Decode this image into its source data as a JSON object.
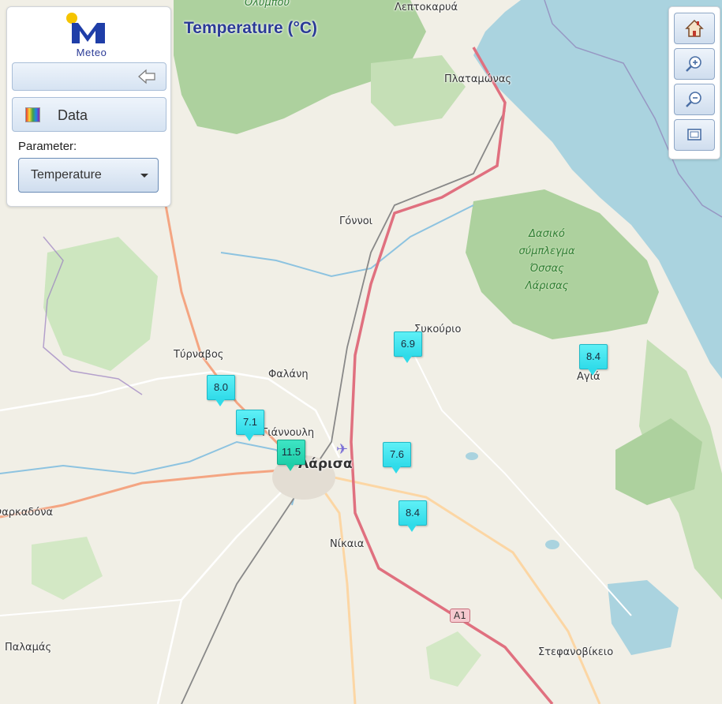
{
  "app": {
    "logo_text": "Meteo",
    "map_title": "Temperature (°C)"
  },
  "panel": {
    "data_button_label": "Data",
    "parameter_label": "Parameter:",
    "parameter_selected": "Temperature"
  },
  "places": [
    {
      "id": "olympou",
      "label": "Ολύμπου"
    },
    {
      "id": "leptokarya",
      "label": "Λεπτοκαρυά"
    },
    {
      "id": "platamonas",
      "label": "Πλαταμώνας"
    },
    {
      "id": "gonnoi",
      "label": "Γόννοι"
    },
    {
      "id": "sykourio",
      "label": "Συκούριο"
    },
    {
      "id": "tyrnavos",
      "label": "Τύρναβος"
    },
    {
      "id": "falani",
      "label": "Φαλάνη"
    },
    {
      "id": "giannouli",
      "label": "Γιάννουλη"
    },
    {
      "id": "larisa",
      "label": "Λάρισα"
    },
    {
      "id": "agia",
      "label": "Αγιά"
    },
    {
      "id": "nikaia",
      "label": "Νίκαια"
    },
    {
      "id": "farkadona",
      "label": "Φαρκαδόνα"
    },
    {
      "id": "palamas",
      "label": "Παλαμάς"
    },
    {
      "id": "stefanovikeio",
      "label": "Στεφανοβίκειο"
    }
  ],
  "forest_label": [
    "Δασικό",
    "σύμπλεγμα",
    "Όσσας",
    "Λάρισας"
  ],
  "road_shield": "A1",
  "stations": [
    {
      "value": "8.0",
      "hot": false
    },
    {
      "value": "7.1",
      "hot": false
    },
    {
      "value": "11.5",
      "hot": true
    },
    {
      "value": "6.9",
      "hot": false
    },
    {
      "value": "7.6",
      "hot": false
    },
    {
      "value": "8.4",
      "hot": false
    },
    {
      "value": "8.4",
      "hot": false
    }
  ],
  "colors": {
    "sea": "#aad3df",
    "land": "#f2efe9",
    "forest": "#add19e",
    "motorway": "#e892a2",
    "primary_road": "#fcd6a4",
    "marker": "#2fdbe9",
    "marker_hot": "#1ecfa9",
    "title": "#2a3a96"
  },
  "toolbar": {
    "home_icon": "home-icon",
    "zoom_in_icon": "zoom-in-icon",
    "zoom_out_icon": "zoom-out-icon",
    "full_extent_icon": "full-extent-icon"
  }
}
